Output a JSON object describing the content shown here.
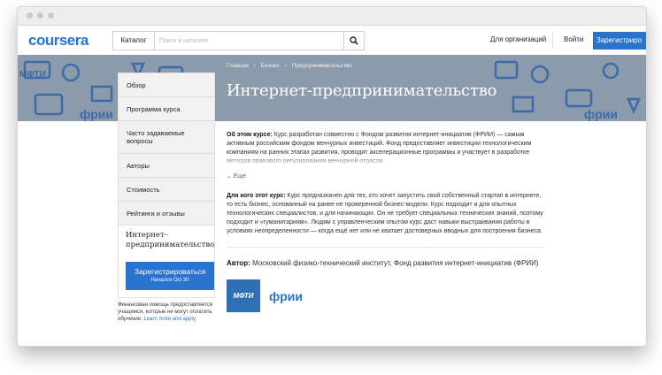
{
  "header": {
    "logo": "coursera",
    "catalog_label": "Каталог",
    "search_placeholder": "Поиск в каталоге",
    "orgs_label": "Для организаций",
    "login_label": "Войти",
    "register_label": "Зарегистриро"
  },
  "banner": {
    "breadcrumbs": [
      "Главная",
      "Бизнес",
      "Предпринимательство"
    ],
    "title": "Интернет-предпринимательство"
  },
  "sidebar": {
    "items": [
      "Обзор",
      "Программа курса",
      "Часто задаваемые вопросы",
      "Авторы",
      "Стоимость",
      "Рейтинги и отзывы"
    ],
    "course_name": "Интернет–предпринимательство",
    "cta_label": "Зарегистрироваться",
    "cta_sub": "Начался Oct 30",
    "aid_text": "Финансовая помощь предоставляется учащимся, которые не могут оплатить обучение.",
    "aid_link": "Learn more and apply."
  },
  "about": {
    "label": "Об этом курсе:",
    "text": "Курс разработан совместно с Фондом развития интернет-инициатив (ФРИИ) — самым активным российским фондом венчурных инвестиций. Фонд предоставляет инвестиции технологическим компаниям на ранних этапах развития, проводит акселерационные программы и участвует в разработке методов правового регулирования венчурной отрасли.",
    "more_label": "Еще"
  },
  "audience": {
    "label": "Для кого этот курс:",
    "text": "Курс предназначен для тех, кто хочет запустить свой собственный стартап в интернете, то есть бизнес, основанный на ранее не проверенной бизнес-модели. Курс подходит и для опытных технологических специалистов, и для начинающих. Он не требует специальных технических знаний, поэтому подходит и «гуманитариям». Людям с управленческим опытом курс даст навыки выстраивания работы в условиях неопределенности — когда ещё нет или не хватает достоверных вводных для построения бизнеса."
  },
  "author": {
    "label": "Автор:",
    "text": "Московский физико-технический институт, Фонд развития интернет-инициатив (ФРИИ)",
    "logo1": "МФТИ",
    "logo2": "фрии"
  },
  "colors": {
    "accent": "#2a73cc",
    "banner": "#8b9bab"
  }
}
